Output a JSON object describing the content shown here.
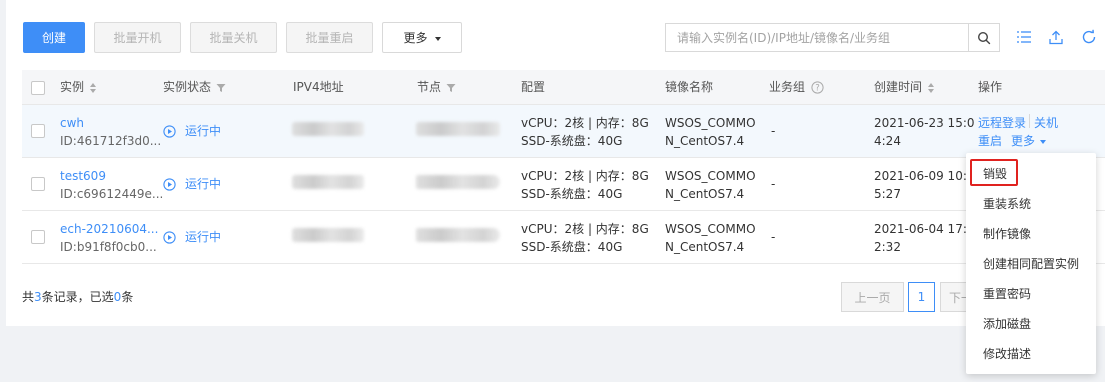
{
  "toolbar": {
    "create_label": "创建",
    "batch_start_label": "批量开机",
    "batch_stop_label": "批量关机",
    "batch_restart_label": "批量重启",
    "more_label": "更多"
  },
  "search": {
    "placeholder": "请输入实例名(ID)/IP地址/镜像名/业务组"
  },
  "icons": {
    "search": "search-icon",
    "columns": "list-settings-icon",
    "export": "upload-icon",
    "refresh": "refresh-icon"
  },
  "table": {
    "headers": {
      "instance": "实例",
      "status": "实例状态",
      "ipv4": "IPV4地址",
      "node": "节点",
      "config": "配置",
      "image": "镜像名称",
      "group": "业务组",
      "created": "创建时间",
      "actions": "操作"
    },
    "rows": [
      {
        "name": "cwh",
        "id": "ID:461712f3d0...",
        "status": "运行中",
        "config_line1": "vCPU：2核 | 内存：8G",
        "config_line2": "SSD-系统盘：40G",
        "image_line1": "WSOS_COMMO",
        "image_line2": "N_CentOS7.4",
        "group": "-",
        "created_line1": "2021-06-23 15:0",
        "created_line2": "4:24",
        "action_remote": "远程登录",
        "action_shutdown": "关机",
        "action_restart": "重启",
        "action_more": "更多"
      },
      {
        "name": "test609",
        "id": "ID:c69612449e...",
        "status": "运行中",
        "config_line1": "vCPU：2核 | 内存：8G",
        "config_line2": "SSD-系统盘：40G",
        "image_line1": "WSOS_COMMO",
        "image_line2": "N_CentOS7.4",
        "group": "-",
        "created_line1": "2021-06-09 10:2",
        "created_line2": "5:27"
      },
      {
        "name": "ech-20210604...",
        "id": "ID:b91f8f0cb0...",
        "status": "运行中",
        "config_line1": "vCPU：2核 | 内存：8G",
        "config_line2": "SSD-系统盘：40G",
        "image_line1": "WSOS_COMMO",
        "image_line2": "N_CentOS7.4",
        "group": "-",
        "created_line1": "2021-06-04 17:2",
        "created_line2": "2:32"
      }
    ]
  },
  "footer": {
    "prefix": "共",
    "total": "3",
    "mid": "条记录，已选",
    "selected": "0",
    "suffix": "条"
  },
  "pagination": {
    "prev_label": "上一页",
    "current_page": "1",
    "next_label": "下一"
  },
  "dropdown": {
    "items": [
      "销毁",
      "重装系统",
      "制作镜像",
      "创建相同配置实例",
      "重置密码",
      "添加磁盘",
      "修改描述"
    ]
  },
  "colors": {
    "accent": "#3e8ef7",
    "highlight": "#e0221f"
  }
}
